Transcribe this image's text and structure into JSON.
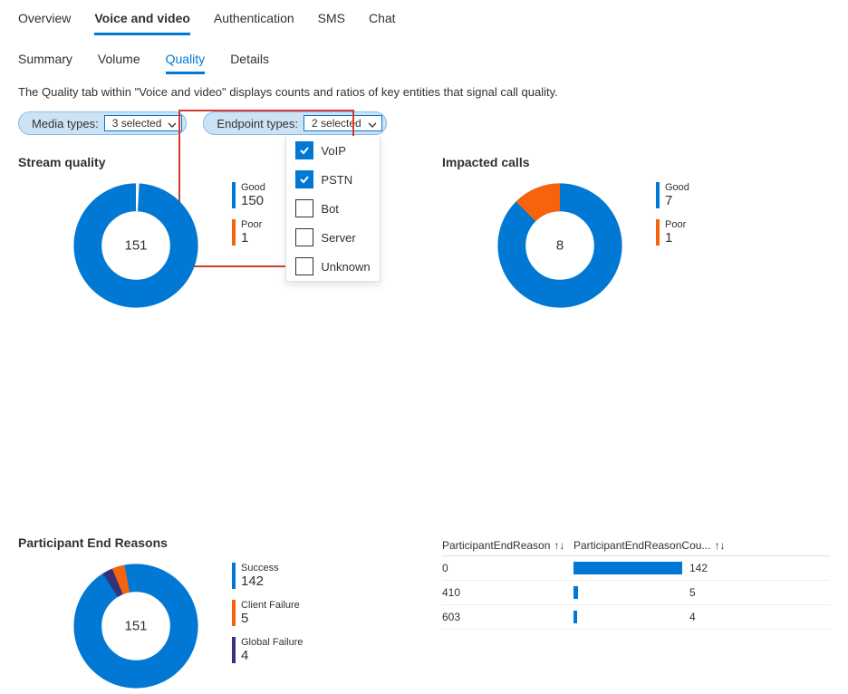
{
  "tabs1": [
    {
      "label": "Overview",
      "active": false
    },
    {
      "label": "Voice and video",
      "active": true
    },
    {
      "label": "Authentication",
      "active": false
    },
    {
      "label": "SMS",
      "active": false
    },
    {
      "label": "Chat",
      "active": false
    }
  ],
  "tabs2": [
    {
      "label": "Summary",
      "active": false
    },
    {
      "label": "Volume",
      "active": false
    },
    {
      "label": "Quality",
      "active": true
    },
    {
      "label": "Details",
      "active": false
    }
  ],
  "description": "The Quality tab within \"Voice and video\" displays counts and ratios of key entities that signal call quality.",
  "filters": {
    "media": {
      "label": "Media types:",
      "value": "3 selected"
    },
    "endpoint": {
      "label": "Endpoint types:",
      "value": "2 selected",
      "options": [
        {
          "label": "VoIP",
          "checked": true
        },
        {
          "label": "PSTN",
          "checked": true
        },
        {
          "label": "Bot",
          "checked": false
        },
        {
          "label": "Server",
          "checked": false
        },
        {
          "label": "Unknown",
          "checked": false
        }
      ]
    }
  },
  "panels": {
    "stream": {
      "title": "Stream quality",
      "total": "151",
      "legend": [
        {
          "name": "Good",
          "value": "150",
          "color": "#0078D4"
        },
        {
          "name": "Poor",
          "value": "1",
          "color": "#F7630C"
        }
      ]
    },
    "impacted": {
      "title": "Impacted calls",
      "total": "8",
      "legend": [
        {
          "name": "Good",
          "value": "7",
          "color": "#0078D4"
        },
        {
          "name": "Poor",
          "value": "1",
          "color": "#F7630C"
        }
      ]
    },
    "reasons": {
      "title": "Participant End Reasons",
      "total": "151",
      "legend": [
        {
          "name": "Success",
          "value": "142",
          "color": "#0078D4"
        },
        {
          "name": "Client Failure",
          "value": "5",
          "color": "#F7630C"
        },
        {
          "name": "Global Failure",
          "value": "4",
          "color": "#373277"
        }
      ]
    },
    "table": {
      "headers": {
        "c1": "ParticipantEndReason",
        "c2": "ParticipantEndReasonCou...",
        "sort": "↑↓"
      },
      "rows": [
        {
          "reason": "0",
          "count": "142",
          "pct": 100
        },
        {
          "reason": "410",
          "count": "5",
          "pct": 4
        },
        {
          "reason": "603",
          "count": "4",
          "pct": 3
        }
      ]
    }
  },
  "chart_data": [
    {
      "type": "pie",
      "title": "Stream quality",
      "series": [
        {
          "name": "Good",
          "value": 150
        },
        {
          "name": "Poor",
          "value": 1
        }
      ],
      "total": 151
    },
    {
      "type": "pie",
      "title": "Impacted calls",
      "series": [
        {
          "name": "Good",
          "value": 7
        },
        {
          "name": "Poor",
          "value": 1
        }
      ],
      "total": 8
    },
    {
      "type": "pie",
      "title": "Participant End Reasons",
      "series": [
        {
          "name": "Success",
          "value": 142
        },
        {
          "name": "Client Failure",
          "value": 5
        },
        {
          "name": "Global Failure",
          "value": 4
        }
      ],
      "total": 151
    },
    {
      "type": "bar",
      "title": "ParticipantEndReasonCount",
      "categories": [
        "0",
        "410",
        "603"
      ],
      "values": [
        142,
        5,
        4
      ]
    }
  ],
  "colors": {
    "blue": "#0078D4",
    "orange": "#F7630C",
    "purple": "#373277"
  }
}
